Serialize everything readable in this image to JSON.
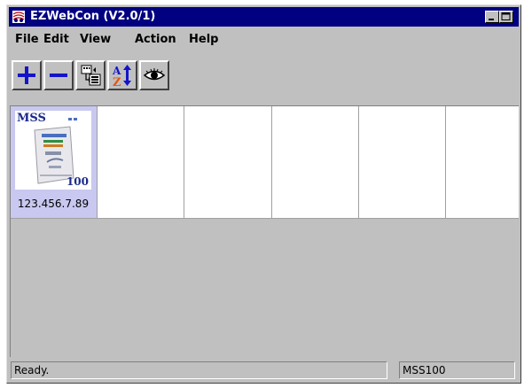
{
  "window": {
    "title": "EZWebCon (V2.0/1)",
    "colors": {
      "titlebar": "#000080",
      "chrome": "#c0c0c0",
      "selection": "#c8c8f0",
      "accent_blue": "#1a2a8c"
    }
  },
  "menubar": {
    "file": "File",
    "edit": "Edit",
    "view": "View",
    "action": "Action",
    "help": "Help"
  },
  "toolbar": {
    "items": [
      "add-icon",
      "remove-icon",
      "properties-list-icon",
      "sort-az-icon",
      "view-eye-icon"
    ]
  },
  "devices": [
    {
      "name_line": "MSS",
      "model": "100",
      "ip": "123.456.7.89",
      "selected": true
    }
  ],
  "status": {
    "message": "Ready.",
    "device": "MSS100"
  }
}
